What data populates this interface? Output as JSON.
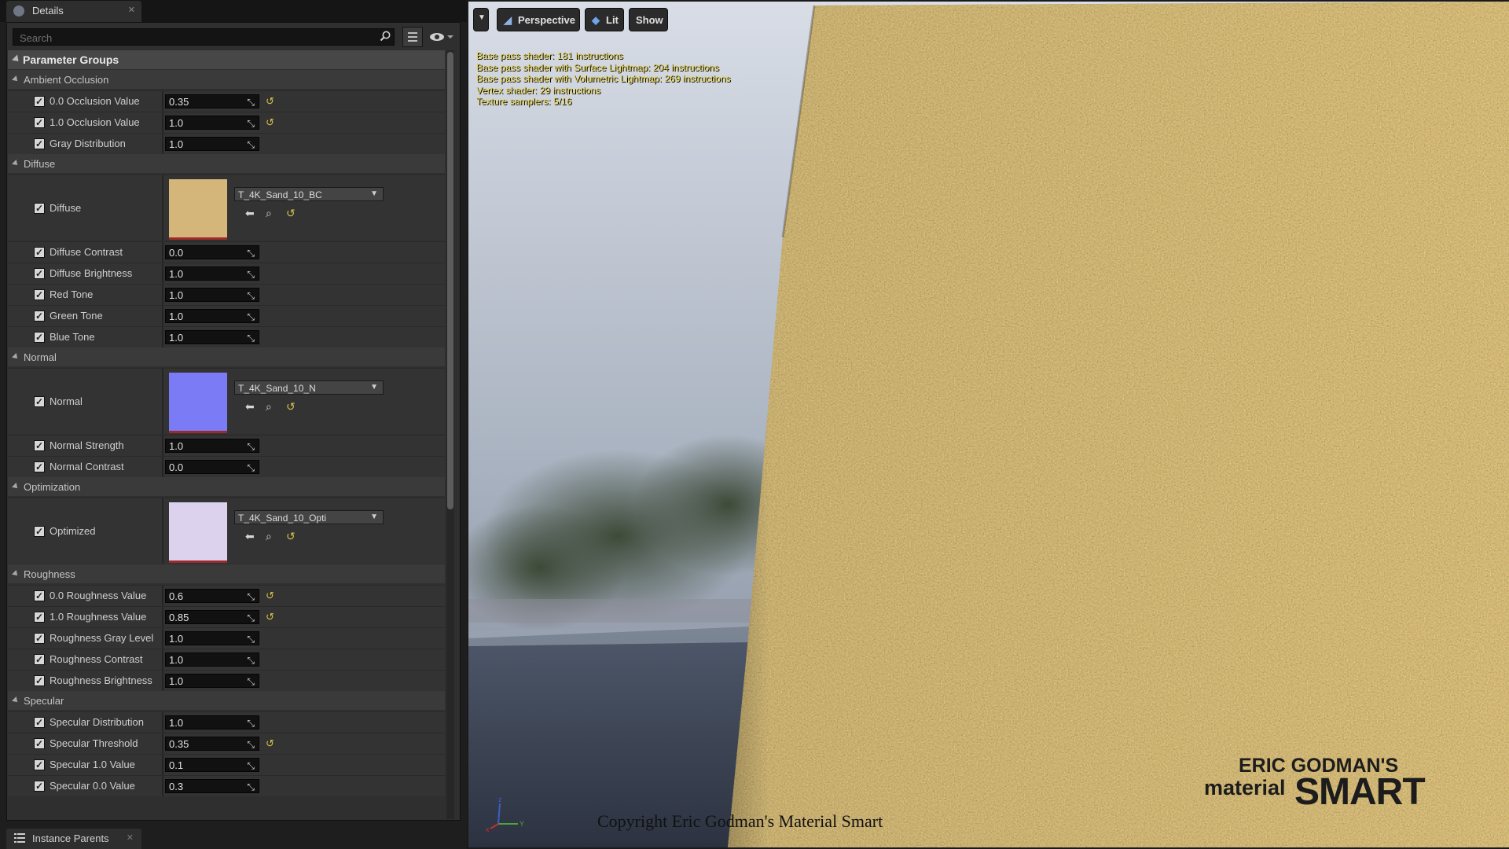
{
  "details_panel": {
    "tab_label": "Details",
    "search_placeholder": "Search",
    "header": "Parameter Groups",
    "groups": [
      {
        "name": "Ambient Occlusion",
        "params": [
          {
            "label": "0.0 Occlusion Value",
            "value": "0.35",
            "reset": true
          },
          {
            "label": "1.0 Occlusion Value",
            "value": "1.0",
            "reset": true
          },
          {
            "label": "Gray Distribution",
            "value": "1.0",
            "reset": false
          }
        ]
      },
      {
        "name": "Diffuse",
        "texture": {
          "label": "Diffuse",
          "asset": "T_4K_Sand_10_BC"
        },
        "params": [
          {
            "label": "Diffuse Contrast",
            "value": "0.0",
            "reset": false
          },
          {
            "label": "Diffuse Brightness",
            "value": "1.0",
            "reset": false
          },
          {
            "label": "Red Tone",
            "value": "1.0",
            "reset": false
          },
          {
            "label": "Green Tone",
            "value": "1.0",
            "reset": false
          },
          {
            "label": "Blue Tone",
            "value": "1.0",
            "reset": false
          }
        ]
      },
      {
        "name": "Normal",
        "texture": {
          "label": "Normal",
          "asset": "T_4K_Sand_10_N"
        },
        "params": [
          {
            "label": "Normal Strength",
            "value": "1.0",
            "reset": false
          },
          {
            "label": "Normal Contrast",
            "value": "0.0",
            "reset": false
          }
        ]
      },
      {
        "name": "Optimization",
        "texture": {
          "label": "Optimized",
          "asset": "T_4K_Sand_10_Opti"
        },
        "params": []
      },
      {
        "name": "Roughness",
        "params": [
          {
            "label": "0.0 Roughness Value",
            "value": "0.6",
            "reset": true
          },
          {
            "label": "1.0 Roughness Value",
            "value": "0.85",
            "reset": true
          },
          {
            "label": "Roughness Gray Level",
            "value": "1.0",
            "reset": false
          },
          {
            "label": "Roughness Contrast",
            "value": "1.0",
            "reset": false
          },
          {
            "label": "Roughness Brightness",
            "value": "1.0",
            "reset": false
          }
        ]
      },
      {
        "name": "Specular",
        "params": [
          {
            "label": "Specular Distribution",
            "value": "1.0",
            "reset": false
          },
          {
            "label": "Specular Threshold",
            "value": "0.35",
            "reset": true
          },
          {
            "label": "Specular 1.0 Value",
            "value": "0.1",
            "reset": false
          },
          {
            "label": "Specular 0.0 Value",
            "value": "0.3",
            "reset": false
          }
        ]
      }
    ],
    "bottom_tab_label": "Instance Parents"
  },
  "viewport": {
    "buttons": {
      "perspective": "Perspective",
      "lit": "Lit",
      "show": "Show"
    },
    "stats": [
      "Base pass shader: 181 instructions",
      "Base pass shader with Surface Lightmap: 204 instructions",
      "Base pass shader with Volumetric Lightmap: 269 instructions",
      "Vertex shader: 29 instructions",
      "Texture samplers: 5/16"
    ],
    "axis_labels": {
      "x": "x",
      "y": "Y",
      "z": "z"
    },
    "copyright": "Copyright Eric Godman's Material Smart",
    "logo": {
      "line1": "ERIC GODMAN'S",
      "line2": "material",
      "line3": "SMART"
    }
  },
  "colors": {
    "accent_reset": "#d6c14a",
    "stats_text": "#e6d24a",
    "diffuse_thumb": "#d4b57a",
    "normal_thumb": "#7b7cf5",
    "opti_thumb": "#ddd2ee"
  },
  "icons": [
    "search-icon",
    "view-options-icon",
    "eye-icon",
    "reset-arrow-icon",
    "use-selected-arrow-icon",
    "browse-icon",
    "dropdown-arrow-icon",
    "list-icon"
  ]
}
